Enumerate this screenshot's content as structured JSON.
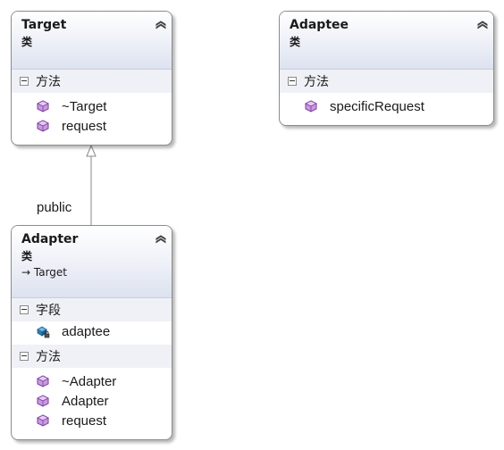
{
  "classes": {
    "target": {
      "name": "Target",
      "kind": "类",
      "collapse_icon": "double-chevron-up",
      "sections": {
        "methods": {
          "title": "方法",
          "members": [
            "~Target",
            "request"
          ]
        }
      }
    },
    "adaptee": {
      "name": "Adaptee",
      "kind": "类",
      "collapse_icon": "double-chevron-up",
      "sections": {
        "methods": {
          "title": "方法",
          "members": [
            "specificRequest"
          ]
        }
      }
    },
    "adapter": {
      "name": "Adapter",
      "kind": "类",
      "base": "Target",
      "collapse_icon": "double-chevron-up",
      "sections": {
        "fields": {
          "title": "字段",
          "members": [
            "adaptee"
          ]
        },
        "methods": {
          "title": "方法",
          "members": [
            "~Adapter",
            "Adapter",
            "request"
          ]
        }
      }
    }
  },
  "relations": {
    "inheritance": {
      "label": "public",
      "from": "Adapter",
      "to": "Target"
    }
  },
  "colors": {
    "method_icon": "#9b4fc2",
    "field_icon": "#1f6fa8",
    "border": "#8c8c8c",
    "section_bg": "#f0f1f7"
  }
}
